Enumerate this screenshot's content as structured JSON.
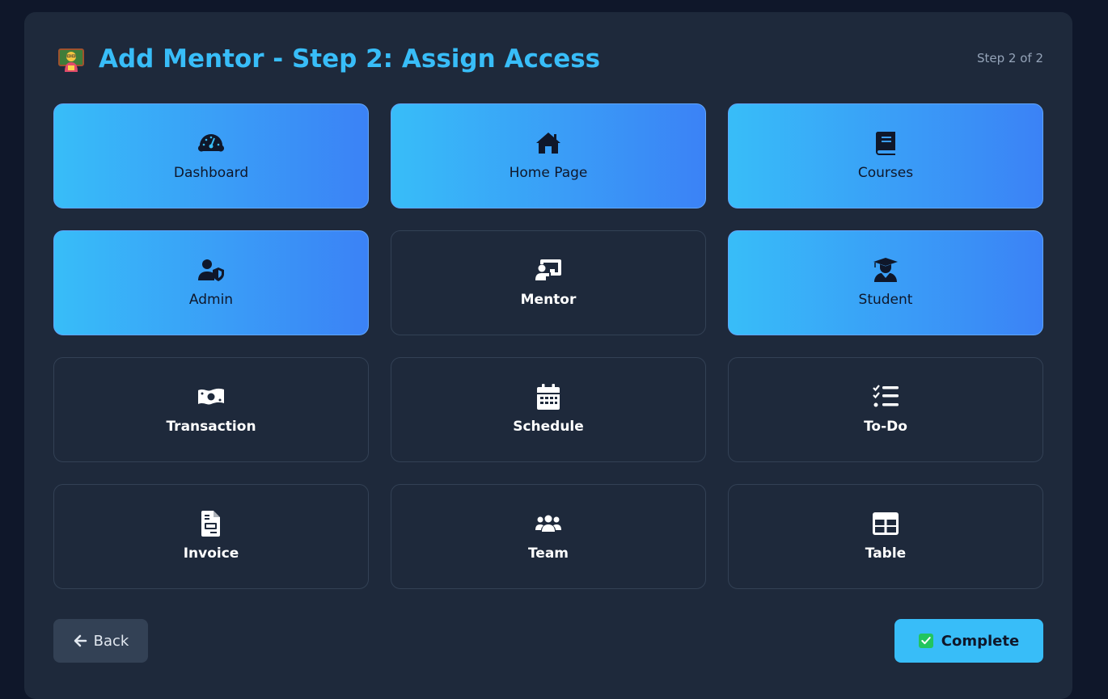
{
  "header": {
    "title": "Add Mentor - Step 2: Assign Access",
    "title_icon": "teacher-emoji",
    "step": "Step 2 of 2"
  },
  "tiles": [
    {
      "label": "Dashboard",
      "icon": "gauge-icon",
      "selected": true
    },
    {
      "label": "Home Page",
      "icon": "home-icon",
      "selected": true
    },
    {
      "label": "Courses",
      "icon": "book-icon",
      "selected": true
    },
    {
      "label": "Admin",
      "icon": "user-shield-icon",
      "selected": true
    },
    {
      "label": "Mentor",
      "icon": "chalkboard-user-icon",
      "selected": false
    },
    {
      "label": "Student",
      "icon": "graduate-icon",
      "selected": true
    },
    {
      "label": "Transaction",
      "icon": "money-bill-icon",
      "selected": false
    },
    {
      "label": "Schedule",
      "icon": "calendar-icon",
      "selected": false
    },
    {
      "label": "To-Do",
      "icon": "list-check-icon",
      "selected": false
    },
    {
      "label": "Invoice",
      "icon": "invoice-icon",
      "selected": false
    },
    {
      "label": "Team",
      "icon": "users-icon",
      "selected": false
    },
    {
      "label": "Table",
      "icon": "table-icon",
      "selected": false
    }
  ],
  "actions": {
    "back_label": "Back",
    "complete_label": "Complete"
  },
  "colors": {
    "accent": "#38bdf8",
    "accent_end": "#3b82f6",
    "panel": "#1e293b",
    "background": "#0f172a"
  }
}
